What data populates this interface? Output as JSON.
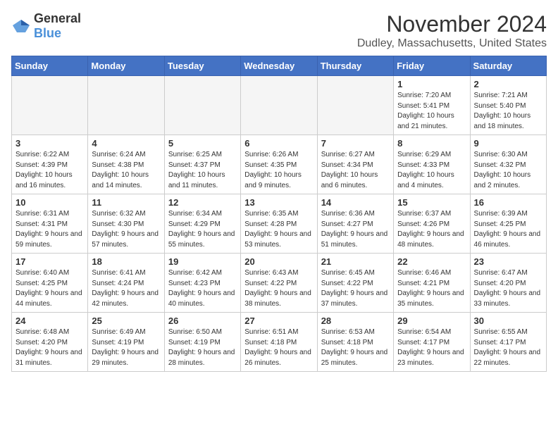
{
  "logo": {
    "general": "General",
    "blue": "Blue"
  },
  "title": "November 2024",
  "location": "Dudley, Massachusetts, United States",
  "weekdays": [
    "Sunday",
    "Monday",
    "Tuesday",
    "Wednesday",
    "Thursday",
    "Friday",
    "Saturday"
  ],
  "weeks": [
    [
      {
        "day": "",
        "info": ""
      },
      {
        "day": "",
        "info": ""
      },
      {
        "day": "",
        "info": ""
      },
      {
        "day": "",
        "info": ""
      },
      {
        "day": "",
        "info": ""
      },
      {
        "day": "1",
        "info": "Sunrise: 7:20 AM\nSunset: 5:41 PM\nDaylight: 10 hours and 21 minutes."
      },
      {
        "day": "2",
        "info": "Sunrise: 7:21 AM\nSunset: 5:40 PM\nDaylight: 10 hours and 18 minutes."
      }
    ],
    [
      {
        "day": "3",
        "info": "Sunrise: 6:22 AM\nSunset: 4:39 PM\nDaylight: 10 hours and 16 minutes."
      },
      {
        "day": "4",
        "info": "Sunrise: 6:24 AM\nSunset: 4:38 PM\nDaylight: 10 hours and 14 minutes."
      },
      {
        "day": "5",
        "info": "Sunrise: 6:25 AM\nSunset: 4:37 PM\nDaylight: 10 hours and 11 minutes."
      },
      {
        "day": "6",
        "info": "Sunrise: 6:26 AM\nSunset: 4:35 PM\nDaylight: 10 hours and 9 minutes."
      },
      {
        "day": "7",
        "info": "Sunrise: 6:27 AM\nSunset: 4:34 PM\nDaylight: 10 hours and 6 minutes."
      },
      {
        "day": "8",
        "info": "Sunrise: 6:29 AM\nSunset: 4:33 PM\nDaylight: 10 hours and 4 minutes."
      },
      {
        "day": "9",
        "info": "Sunrise: 6:30 AM\nSunset: 4:32 PM\nDaylight: 10 hours and 2 minutes."
      }
    ],
    [
      {
        "day": "10",
        "info": "Sunrise: 6:31 AM\nSunset: 4:31 PM\nDaylight: 9 hours and 59 minutes."
      },
      {
        "day": "11",
        "info": "Sunrise: 6:32 AM\nSunset: 4:30 PM\nDaylight: 9 hours and 57 minutes."
      },
      {
        "day": "12",
        "info": "Sunrise: 6:34 AM\nSunset: 4:29 PM\nDaylight: 9 hours and 55 minutes."
      },
      {
        "day": "13",
        "info": "Sunrise: 6:35 AM\nSunset: 4:28 PM\nDaylight: 9 hours and 53 minutes."
      },
      {
        "day": "14",
        "info": "Sunrise: 6:36 AM\nSunset: 4:27 PM\nDaylight: 9 hours and 51 minutes."
      },
      {
        "day": "15",
        "info": "Sunrise: 6:37 AM\nSunset: 4:26 PM\nDaylight: 9 hours and 48 minutes."
      },
      {
        "day": "16",
        "info": "Sunrise: 6:39 AM\nSunset: 4:25 PM\nDaylight: 9 hours and 46 minutes."
      }
    ],
    [
      {
        "day": "17",
        "info": "Sunrise: 6:40 AM\nSunset: 4:25 PM\nDaylight: 9 hours and 44 minutes."
      },
      {
        "day": "18",
        "info": "Sunrise: 6:41 AM\nSunset: 4:24 PM\nDaylight: 9 hours and 42 minutes."
      },
      {
        "day": "19",
        "info": "Sunrise: 6:42 AM\nSunset: 4:23 PM\nDaylight: 9 hours and 40 minutes."
      },
      {
        "day": "20",
        "info": "Sunrise: 6:43 AM\nSunset: 4:22 PM\nDaylight: 9 hours and 38 minutes."
      },
      {
        "day": "21",
        "info": "Sunrise: 6:45 AM\nSunset: 4:22 PM\nDaylight: 9 hours and 37 minutes."
      },
      {
        "day": "22",
        "info": "Sunrise: 6:46 AM\nSunset: 4:21 PM\nDaylight: 9 hours and 35 minutes."
      },
      {
        "day": "23",
        "info": "Sunrise: 6:47 AM\nSunset: 4:20 PM\nDaylight: 9 hours and 33 minutes."
      }
    ],
    [
      {
        "day": "24",
        "info": "Sunrise: 6:48 AM\nSunset: 4:20 PM\nDaylight: 9 hours and 31 minutes."
      },
      {
        "day": "25",
        "info": "Sunrise: 6:49 AM\nSunset: 4:19 PM\nDaylight: 9 hours and 29 minutes."
      },
      {
        "day": "26",
        "info": "Sunrise: 6:50 AM\nSunset: 4:19 PM\nDaylight: 9 hours and 28 minutes."
      },
      {
        "day": "27",
        "info": "Sunrise: 6:51 AM\nSunset: 4:18 PM\nDaylight: 9 hours and 26 minutes."
      },
      {
        "day": "28",
        "info": "Sunrise: 6:53 AM\nSunset: 4:18 PM\nDaylight: 9 hours and 25 minutes."
      },
      {
        "day": "29",
        "info": "Sunrise: 6:54 AM\nSunset: 4:17 PM\nDaylight: 9 hours and 23 minutes."
      },
      {
        "day": "30",
        "info": "Sunrise: 6:55 AM\nSunset: 4:17 PM\nDaylight: 9 hours and 22 minutes."
      }
    ]
  ]
}
